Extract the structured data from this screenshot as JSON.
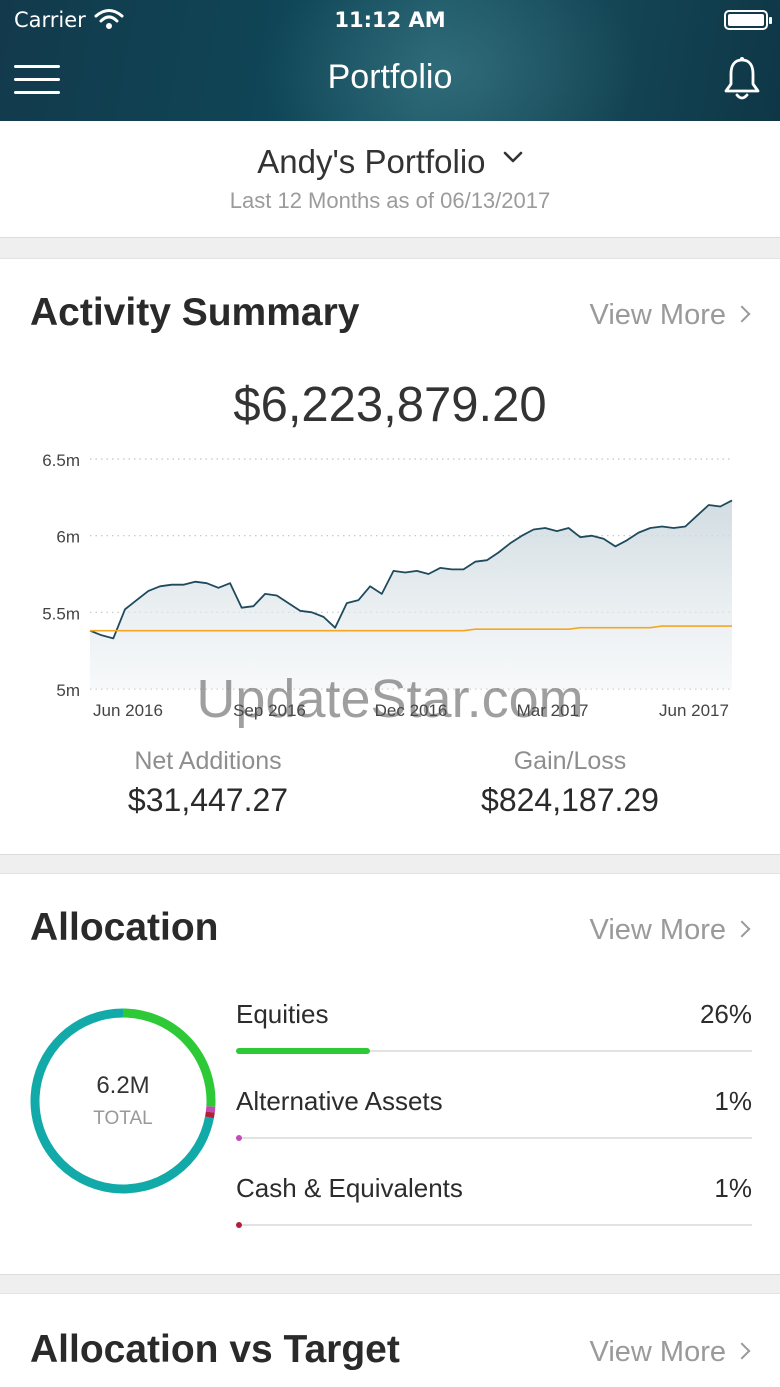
{
  "status_bar": {
    "carrier": "Carrier",
    "time": "11:12 AM"
  },
  "nav": {
    "title": "Portfolio"
  },
  "portfolio": {
    "name": "Andy's Portfolio",
    "subtitle": "Last 12 Months as of 06/13/2017"
  },
  "activity": {
    "title": "Activity Summary",
    "view_more": "View More",
    "total": "$6,223,879.20",
    "net_additions_label": "Net Additions",
    "net_additions_value": "$31,447.27",
    "gain_loss_label": "Gain/Loss",
    "gain_loss_value": "$824,187.29"
  },
  "chart_data": {
    "type": "area",
    "x_tick_labels": [
      "Jun 2016",
      "Sep 2016",
      "Dec 2016",
      "Mar 2017",
      "Jun 2017"
    ],
    "y_tick_labels": [
      "6.5m",
      "6m",
      "5.5m",
      "5m"
    ],
    "ylim": [
      5.0,
      6.5
    ],
    "grid": true,
    "series": [
      {
        "color": "#1f4a5e",
        "fill": true,
        "values": [
          5.38,
          5.35,
          5.33,
          5.52,
          5.58,
          5.64,
          5.67,
          5.68,
          5.68,
          5.7,
          5.69,
          5.66,
          5.69,
          5.53,
          5.54,
          5.62,
          5.61,
          5.56,
          5.51,
          5.5,
          5.47,
          5.4,
          5.56,
          5.58,
          5.67,
          5.62,
          5.77,
          5.76,
          5.77,
          5.75,
          5.79,
          5.78,
          5.78,
          5.83,
          5.84,
          5.89,
          5.95,
          6.0,
          6.04,
          6.05,
          6.03,
          6.05,
          5.99,
          6.0,
          5.98,
          5.93,
          5.97,
          6.02,
          6.05,
          6.06,
          6.05,
          6.06,
          6.13,
          6.2,
          6.19,
          6.23
        ]
      },
      {
        "color": "#f5a623",
        "fill": false,
        "values": [
          5.38,
          5.38,
          5.38,
          5.38,
          5.38,
          5.38,
          5.38,
          5.38,
          5.38,
          5.38,
          5.38,
          5.38,
          5.38,
          5.38,
          5.38,
          5.38,
          5.38,
          5.38,
          5.38,
          5.38,
          5.38,
          5.38,
          5.38,
          5.38,
          5.38,
          5.38,
          5.38,
          5.38,
          5.38,
          5.38,
          5.38,
          5.38,
          5.38,
          5.39,
          5.39,
          5.39,
          5.39,
          5.39,
          5.39,
          5.39,
          5.39,
          5.39,
          5.4,
          5.4,
          5.4,
          5.4,
          5.4,
          5.4,
          5.4,
          5.41,
          5.41,
          5.41,
          5.41,
          5.41,
          5.41,
          5.41
        ]
      }
    ]
  },
  "allocation": {
    "title": "Allocation",
    "view_more": "View More",
    "total_value": "6.2M",
    "total_label": "TOTAL",
    "rows": [
      {
        "name": "Equities",
        "pct": "26%",
        "fraction": 0.26,
        "color": "#2dc937"
      },
      {
        "name": "Alternative Assets",
        "pct": "1%",
        "fraction": 0.01,
        "color": "#c44ab8"
      },
      {
        "name": "Cash & Equivalents",
        "pct": "1%",
        "fraction": 0.01,
        "color": "#b0203a"
      }
    ],
    "remaining_color": "#12aaa8"
  },
  "target": {
    "title": "Allocation vs Target",
    "view_more": "View More"
  },
  "watermark": "UpdateStar.com"
}
